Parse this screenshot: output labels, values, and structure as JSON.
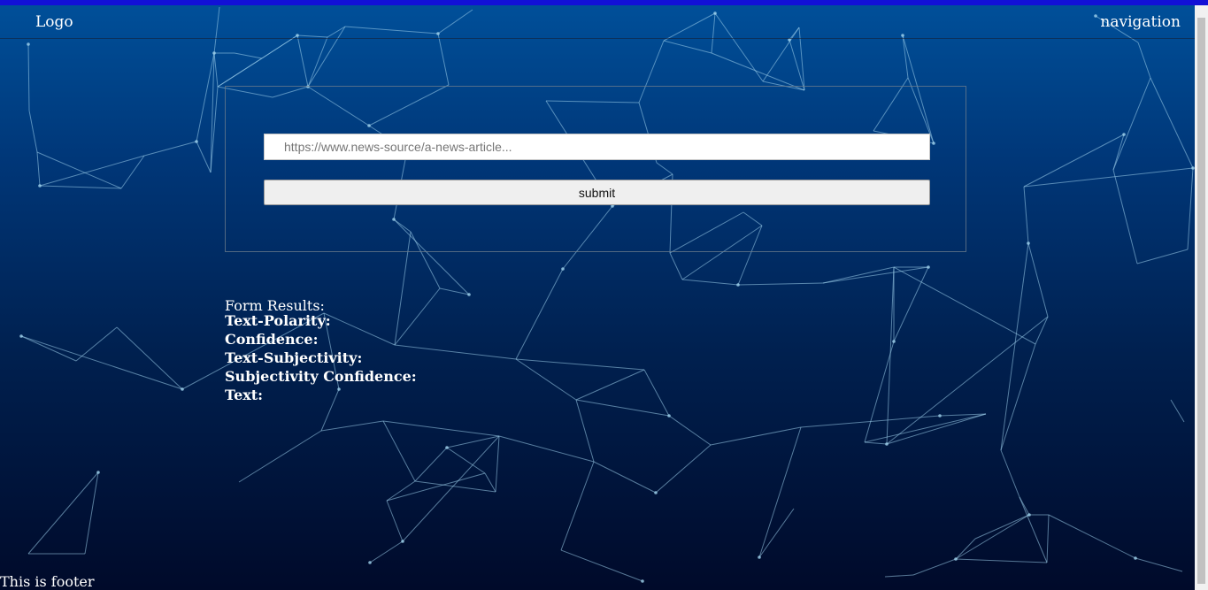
{
  "header": {
    "logo": "Logo",
    "navigation": "navigation"
  },
  "form": {
    "url_placeholder": "https://www.news-source/a-news-article...",
    "url_value": "",
    "submit_label": "submit"
  },
  "results": {
    "heading": "Form Results:",
    "polarity_label": "Text-Polarity:",
    "confidence_label": "Confidence:",
    "subjectivity_label": "Text-Subjectivity:",
    "subjectivity_confidence_label": "Subjectivity Confidence:",
    "text_label": "Text:"
  },
  "footer": {
    "text": "This is footer"
  },
  "colors": {
    "top_strip": "#1210d6",
    "gradient_top": "#00509a",
    "gradient_bottom": "#000a2a",
    "network_lines": "#9fd2ec"
  }
}
